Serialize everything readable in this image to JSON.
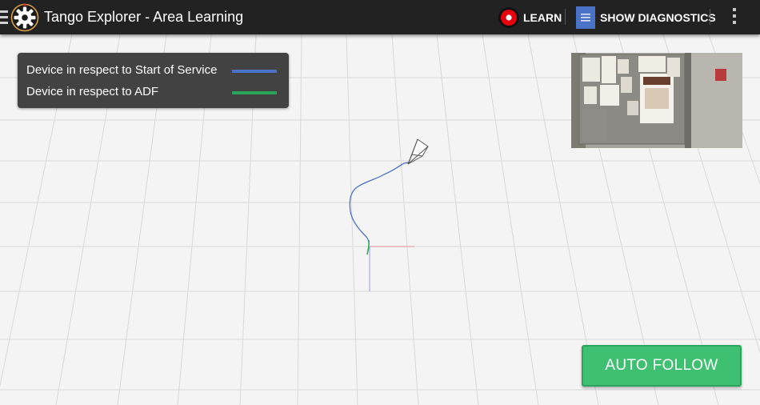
{
  "app": {
    "title": "Tango Explorer - Area Learning"
  },
  "toolbar": {
    "learn_label": "LEARN",
    "diagnostics_label": "SHOW DIAGNOSTICS"
  },
  "legend": {
    "items": [
      {
        "label": "Device in respect to Start of Service",
        "color": "#4a72c7"
      },
      {
        "label": "Device in respect to ADF",
        "color": "#29a65a"
      }
    ]
  },
  "colors": {
    "appbar": "#222222",
    "record": "#e8000e",
    "auto_follow": "#3ec070"
  },
  "icons": [
    "menu-icon",
    "gear-icon",
    "record-icon",
    "document-icon",
    "overflow-menu-icon"
  ],
  "auto_follow_label": "AUTO FOLLOW"
}
